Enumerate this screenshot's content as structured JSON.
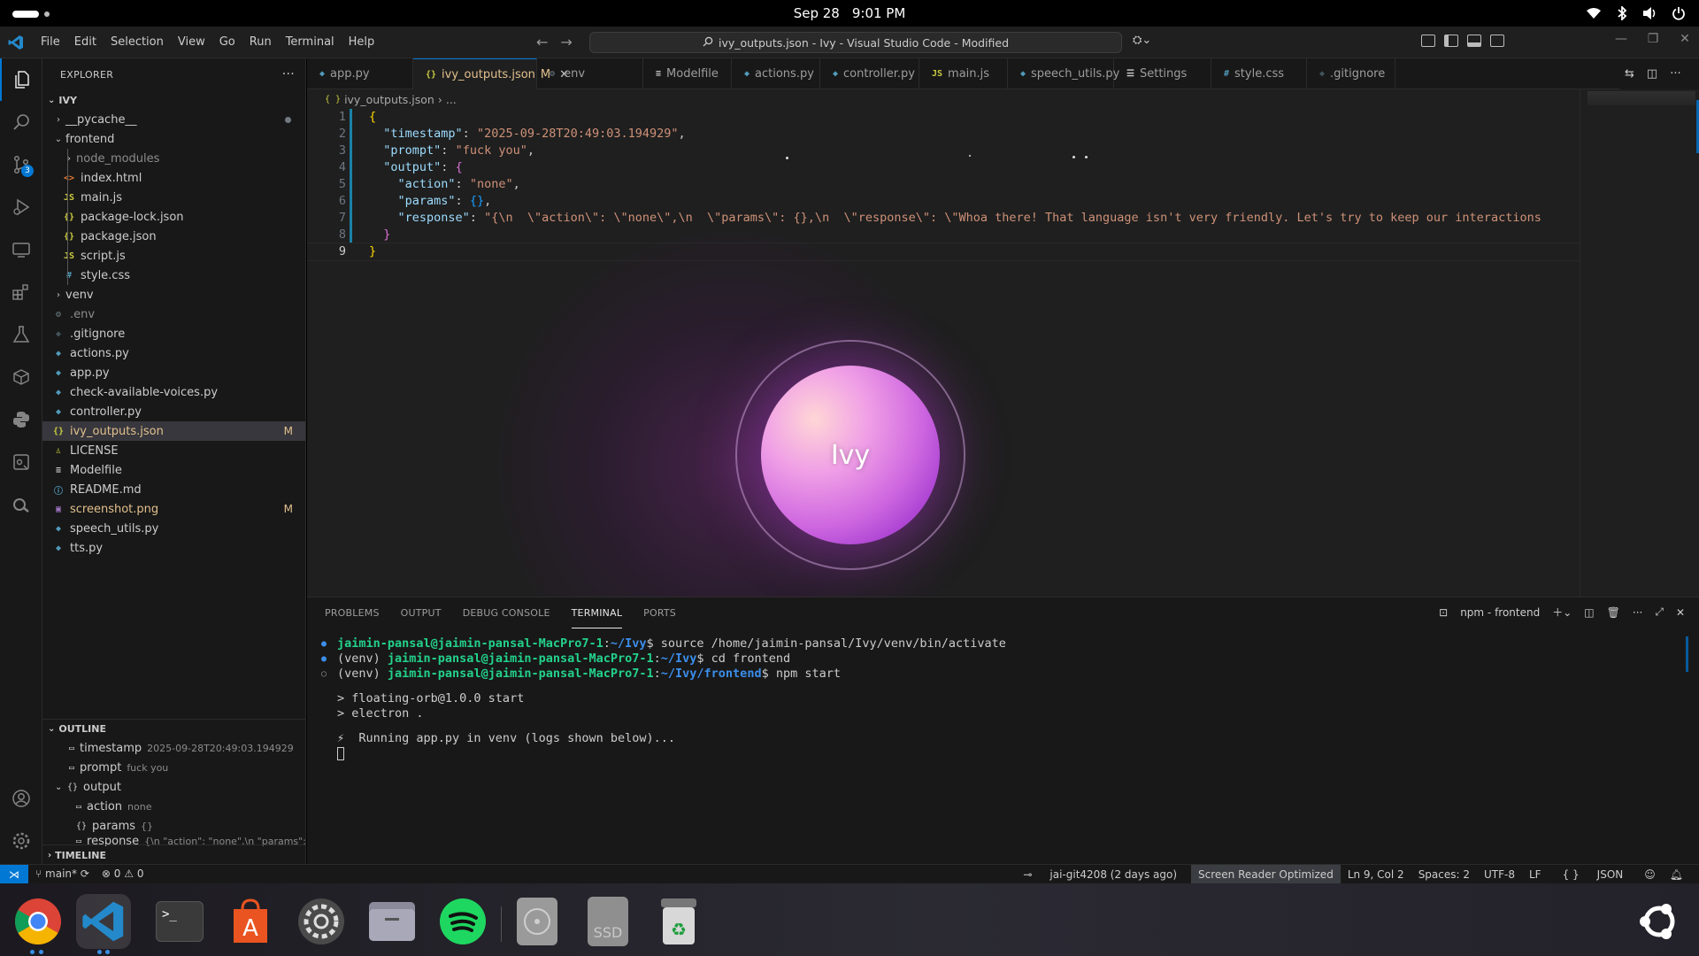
{
  "topbar": {
    "date": "Sep 28",
    "time": "9:01 PM"
  },
  "titlebar": {
    "menu": [
      "File",
      "Edit",
      "Selection",
      "View",
      "Go",
      "Run",
      "Terminal",
      "Help"
    ],
    "search_text": "ivy_outputs.json - Ivy - Visual Studio Code - Modified"
  },
  "activitybar": {
    "scm_badge": "3"
  },
  "explorer": {
    "title": "EXPLORER",
    "root": "IVY",
    "items": [
      {
        "label": "__pycache__",
        "kind": "folder",
        "depth": 1,
        "open": false,
        "icon": "folder"
      },
      {
        "label": "frontend",
        "kind": "folder",
        "depth": 1,
        "open": true,
        "icon": "folder"
      },
      {
        "label": "node_modules",
        "kind": "folder",
        "depth": 2,
        "open": false,
        "icon": "folder",
        "dim": true
      },
      {
        "label": "index.html",
        "kind": "file",
        "depth": 2,
        "icon": "html"
      },
      {
        "label": "main.js",
        "kind": "file",
        "depth": 2,
        "icon": "js"
      },
      {
        "label": "package-lock.json",
        "kind": "file",
        "depth": 2,
        "icon": "json"
      },
      {
        "label": "package.json",
        "kind": "file",
        "depth": 2,
        "icon": "json"
      },
      {
        "label": "script.js",
        "kind": "file",
        "depth": 2,
        "icon": "js"
      },
      {
        "label": "style.css",
        "kind": "file",
        "depth": 2,
        "icon": "css"
      },
      {
        "label": "venv",
        "kind": "folder",
        "depth": 1,
        "open": false,
        "icon": "folder"
      },
      {
        "label": ".env",
        "kind": "file",
        "depth": 1,
        "icon": "gear",
        "dim": true
      },
      {
        "label": ".gitignore",
        "kind": "file",
        "depth": 1,
        "icon": "git"
      },
      {
        "label": "actions.py",
        "kind": "file",
        "depth": 1,
        "icon": "python"
      },
      {
        "label": "app.py",
        "kind": "file",
        "depth": 1,
        "icon": "python"
      },
      {
        "label": "check-available-voices.py",
        "kind": "file",
        "depth": 1,
        "icon": "python"
      },
      {
        "label": "controller.py",
        "kind": "file",
        "depth": 1,
        "icon": "python"
      },
      {
        "label": "ivy_outputs.json",
        "kind": "file",
        "depth": 1,
        "icon": "json",
        "selected": true,
        "decoration": "M"
      },
      {
        "label": "LICENSE",
        "kind": "file",
        "depth": 1,
        "icon": "license"
      },
      {
        "label": "Modelfile",
        "kind": "file",
        "depth": 1,
        "icon": "text"
      },
      {
        "label": "README.md",
        "kind": "file",
        "depth": 1,
        "icon": "info"
      },
      {
        "label": "screenshot.png",
        "kind": "file",
        "depth": 1,
        "icon": "image",
        "decoration": "M"
      },
      {
        "label": "speech_utils.py",
        "kind": "file",
        "depth": 1,
        "icon": "python"
      },
      {
        "label": "tts.py",
        "kind": "file",
        "depth": 1,
        "icon": "python"
      }
    ]
  },
  "outline": {
    "title": "OUTLINE",
    "items": [
      {
        "label": "timestamp",
        "detail": "2025-09-28T20:49:03.194929",
        "depth": 1
      },
      {
        "label": "prompt",
        "detail": "fuck you",
        "depth": 1
      },
      {
        "label": "output",
        "detail": "",
        "depth": 1,
        "open": true
      },
      {
        "label": "action",
        "detail": "none",
        "depth": 2
      },
      {
        "label": "params",
        "detail": "{}",
        "depth": 2
      },
      {
        "label": "response",
        "detail": "{\\n  \"action\": \"none\",\\n  \"params\":...",
        "depth": 2
      }
    ]
  },
  "timeline": {
    "title": "TIMELINE"
  },
  "tabs": [
    {
      "label": "app.py",
      "icon": "python"
    },
    {
      "label": "ivy_outputs.json",
      "icon": "json",
      "active": true,
      "modified": "M"
    },
    {
      "label": ".env",
      "icon": "gear"
    },
    {
      "label": "Modelfile",
      "icon": "text"
    },
    {
      "label": "actions.py",
      "icon": "python"
    },
    {
      "label": "controller.py",
      "icon": "python"
    },
    {
      "label": "main.js",
      "icon": "js"
    },
    {
      "label": "speech_utils.py",
      "icon": "python"
    },
    {
      "label": "Settings",
      "icon": "settings"
    },
    {
      "label": "style.css",
      "icon": "css"
    },
    {
      "label": ".gitignore",
      "icon": "git"
    }
  ],
  "breadcrumb": {
    "file": "ivy_outputs.json",
    "more": "..."
  },
  "code": {
    "current_line": 9,
    "lines": [
      [
        {
          "t": "{",
          "c": "b1"
        }
      ],
      [
        {
          "t": "  "
        },
        {
          "t": "\"timestamp\"",
          "c": "k"
        },
        {
          "t": ": ",
          "c": "p"
        },
        {
          "t": "\"2025-09-28T20:49:03.194929\"",
          "c": "s"
        },
        {
          "t": ",",
          "c": "p"
        }
      ],
      [
        {
          "t": "  "
        },
        {
          "t": "\"prompt\"",
          "c": "k"
        },
        {
          "t": ": ",
          "c": "p"
        },
        {
          "t": "\"fuck you\"",
          "c": "s"
        },
        {
          "t": ",",
          "c": "p"
        }
      ],
      [
        {
          "t": "  "
        },
        {
          "t": "\"output\"",
          "c": "k"
        },
        {
          "t": ": ",
          "c": "p"
        },
        {
          "t": "{",
          "c": "b2"
        }
      ],
      [
        {
          "t": "    "
        },
        {
          "t": "\"action\"",
          "c": "k"
        },
        {
          "t": ": ",
          "c": "p"
        },
        {
          "t": "\"none\"",
          "c": "s"
        },
        {
          "t": ",",
          "c": "p"
        }
      ],
      [
        {
          "t": "    "
        },
        {
          "t": "\"params\"",
          "c": "k"
        },
        {
          "t": ": ",
          "c": "p"
        },
        {
          "t": "{}",
          "c": "b3"
        },
        {
          "t": ",",
          "c": "p"
        }
      ],
      [
        {
          "t": "    "
        },
        {
          "t": "\"response\"",
          "c": "k"
        },
        {
          "t": ": ",
          "c": "p"
        },
        {
          "t": "\"{\\n  \\\"action\\\": \\\"none\\\",\\n  \\\"params\\\": {},\\n  \\\"response\\\": \\\"Whoa there! That language isn't very friendly. Let's try to keep our interactions",
          "c": "s"
        }
      ],
      [
        {
          "t": "  "
        },
        {
          "t": "}",
          "c": "b2"
        }
      ],
      [
        {
          "t": "}",
          "c": "b1"
        }
      ]
    ]
  },
  "orb": {
    "label": "Ivy"
  },
  "panel": {
    "tabs": [
      "PROBLEMS",
      "OUTPUT",
      "DEBUG CONSOLE",
      "TERMINAL",
      "PORTS"
    ],
    "active_tab": "TERMINAL",
    "terminal_name": "npm - frontend"
  },
  "terminal": {
    "lines": [
      {
        "marker": "filled",
        "prefix": "",
        "user": "jaimin-pansal@jaimin-pansal-MacPro7-1",
        "path": "~/Ivy",
        "cmd": "$ source /home/jaimin-pansal/Ivy/venv/bin/activate"
      },
      {
        "marker": "filled",
        "prefix": "(venv) ",
        "user": "jaimin-pansal@jaimin-pansal-MacPro7-1",
        "path": "~/Ivy",
        "cmd": "$ cd frontend"
      },
      {
        "marker": "hollow",
        "prefix": "(venv) ",
        "user": "jaimin-pansal@jaimin-pansal-MacPro7-1",
        "path": "~/Ivy/frontend",
        "cmd": "$ npm start"
      },
      {
        "text": ""
      },
      {
        "text": "> floating-orb@1.0.0 start"
      },
      {
        "text": "> electron ."
      },
      {
        "text": ""
      },
      {
        "text": "⚡  Running app.py in venv (logs shown below)..."
      }
    ]
  },
  "statusbar": {
    "branch": "main*",
    "errors": "0",
    "warnings": "0",
    "blame": "jai-git4208 (2 days ago)",
    "screen_reader": "Screen Reader Optimized",
    "position": "Ln 9, Col 2",
    "spaces": "Spaces: 2",
    "encoding": "UTF-8",
    "eol": "LF",
    "language": "JSON"
  },
  "dock": {
    "apps": [
      "chrome-icon",
      "vscode-icon",
      "terminal-icon",
      "app-center-icon",
      "settings-icon",
      "files-icon",
      "spotify-icon",
      "disc-icon",
      "ssd-icon",
      "trash-icon"
    ],
    "ssd_label": "SSD"
  },
  "colors": {
    "accent": "#0078d4",
    "editor_bg": "#1f1f1f",
    "sidebar_bg": "#181818",
    "modified": "#e2c08d",
    "orb_purple": "#cf68e0"
  }
}
